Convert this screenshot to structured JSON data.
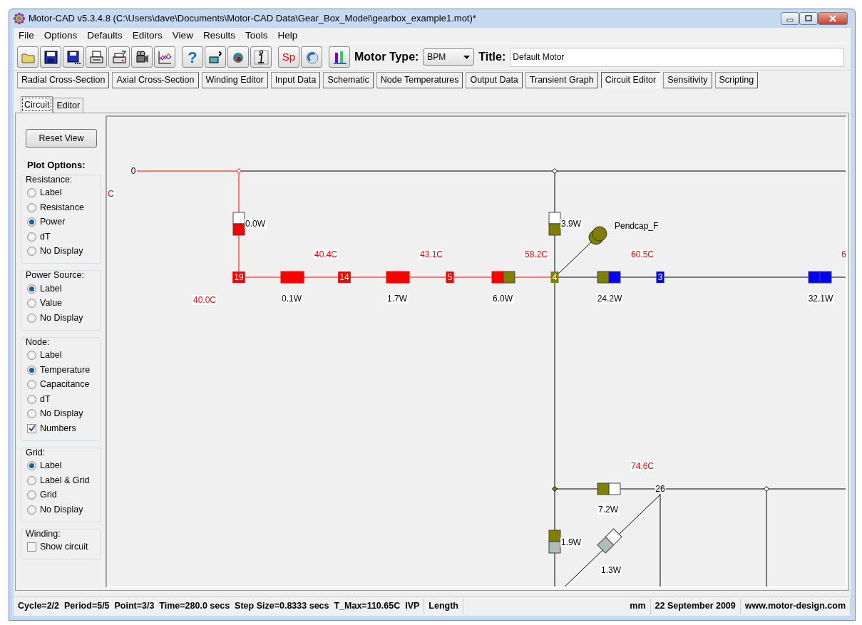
{
  "window": {
    "title": "Motor-CAD v5.3.4.8 (C:\\Users\\dave\\Documents\\Motor-CAD Data\\Gear_Box_Model\\gearbox_example1.mot)*"
  },
  "menu": [
    "File",
    "Options",
    "Defaults",
    "Editors",
    "View",
    "Results",
    "Tools",
    "Help"
  ],
  "toolbar": {
    "buttons": [
      {
        "kind": "open"
      },
      {
        "kind": "save"
      },
      {
        "kind": "save-all"
      },
      {
        "kind": "print"
      },
      {
        "kind": "print-setup"
      },
      {
        "kind": "camera"
      },
      {
        "kind": "graph"
      },
      {
        "kind": "help",
        "glyph": "?"
      },
      {
        "kind": "book"
      },
      {
        "kind": "pointer"
      },
      {
        "kind": "info"
      },
      {
        "kind": "text",
        "glyph": "Sp"
      },
      {
        "kind": "magnet"
      },
      {
        "kind": "plot"
      }
    ],
    "motor_type_label": "Motor Type:",
    "motor_type": "BPM",
    "title_label": "Title:",
    "title_value": "Default Motor"
  },
  "tabs": [
    {
      "label": "Radial Cross-Section",
      "selected": false
    },
    {
      "label": "Axial Cross-Section",
      "selected": false
    },
    {
      "label": "Winding Editor",
      "selected": false
    },
    {
      "label": "Input Data",
      "selected": false
    },
    {
      "label": "Schematic",
      "selected": false
    },
    {
      "label": "Node Temperatures",
      "selected": false
    },
    {
      "label": "Output Data",
      "selected": false
    },
    {
      "label": "Transient Graph",
      "selected": false
    },
    {
      "label": "Circuit Editor",
      "selected": true
    },
    {
      "label": "Sensitivity",
      "selected": false
    },
    {
      "label": "Scripting",
      "selected": false
    }
  ],
  "subtabs": [
    {
      "label": "Circuit",
      "selected": true
    },
    {
      "label": "Editor",
      "selected": false
    }
  ],
  "sidebar": {
    "reset_button": "Reset View",
    "heading": "Plot Options:",
    "groups": [
      {
        "title": "Resistance:",
        "options": [
          {
            "kind": "radio",
            "label": "Label",
            "checked": false
          },
          {
            "kind": "radio",
            "label": "Resistance",
            "checked": false
          },
          {
            "kind": "radio",
            "label": "Power",
            "checked": true
          },
          {
            "kind": "radio",
            "label": "dT",
            "checked": false
          },
          {
            "kind": "radio",
            "label": "No Display",
            "checked": false
          }
        ]
      },
      {
        "title": "Power Source:",
        "options": [
          {
            "kind": "radio",
            "label": "Label",
            "checked": true
          },
          {
            "kind": "radio",
            "label": "Value",
            "checked": false
          },
          {
            "kind": "radio",
            "label": "No Display",
            "checked": false
          }
        ]
      },
      {
        "title": "Node:",
        "options": [
          {
            "kind": "radio",
            "label": "Label",
            "checked": false
          },
          {
            "kind": "radio",
            "label": "Temperature",
            "checked": true
          },
          {
            "kind": "radio",
            "label": "Capacitance",
            "checked": false
          },
          {
            "kind": "radio",
            "label": "dT",
            "checked": false
          },
          {
            "kind": "radio",
            "label": "No Display",
            "checked": false
          },
          {
            "kind": "checkbox",
            "label": "Numbers",
            "checked": true
          }
        ]
      },
      {
        "title": "Grid:",
        "options": [
          {
            "kind": "radio",
            "label": "Label",
            "checked": true
          },
          {
            "kind": "radio",
            "label": "Label & Grid",
            "checked": false
          },
          {
            "kind": "radio",
            "label": "Grid",
            "checked": false
          },
          {
            "kind": "radio",
            "label": "No Display",
            "checked": false
          }
        ]
      },
      {
        "title": "Winding:",
        "options": [
          {
            "kind": "checkbox",
            "label": "Show circuit",
            "checked": false
          }
        ]
      }
    ]
  },
  "circuit": {
    "nodes": [
      {
        "kind": "plain",
        "label": "0"
      },
      {
        "kind": "boxed",
        "label": "19",
        "color": "#ff0000"
      },
      {
        "kind": "boxed",
        "label": "14",
        "color": "#ff0000"
      },
      {
        "kind": "boxed",
        "label": "5",
        "color": "#ff0000"
      },
      {
        "kind": "boxed",
        "label": "4",
        "color": "#808000"
      },
      {
        "kind": "boxed",
        "label": "3",
        "color": "#0000ff"
      },
      {
        "kind": "plain",
        "label": "26"
      }
    ],
    "power_labels": [
      "0.0W",
      "3.9W",
      "0.1W",
      "1.7W",
      "6.0W",
      "24.2W",
      "32.1W",
      "7.2W",
      "1.9W",
      "1.3W"
    ],
    "temperature_labels": [
      "C",
      "40.4C",
      "43.1C",
      "58.2C",
      "60.5C",
      "6",
      "40.0C",
      "74.6C"
    ],
    "component_labels": [
      "Pendcap_F"
    ]
  },
  "status_bar": [
    "Cycle=2/2  Period=5/5  Point=3/3  Time=280.0 secs  Step Size=0.8333 secs  T_Max=110.65C  IVP",
    "Length",
    "mm",
    "22 September 2009",
    "www.motor-design.com"
  ]
}
